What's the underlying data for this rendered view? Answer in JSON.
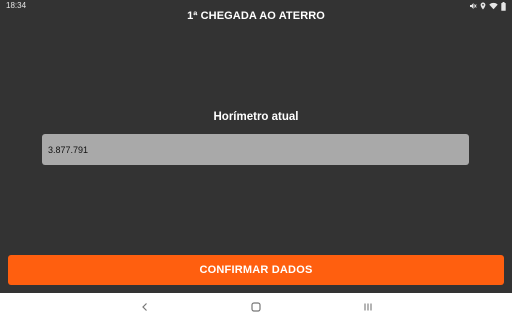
{
  "status_bar": {
    "time": "18:34",
    "icons": [
      "mute-icon",
      "location-icon",
      "wifi-icon",
      "battery-icon"
    ]
  },
  "header": {
    "title": "1ª CHEGADA AO ATERRO"
  },
  "form": {
    "field_label": "Horímetro atual",
    "field_value": "3.877.791"
  },
  "actions": {
    "confirm_label": "CONFIRMAR DADOS"
  },
  "nav_bar": {
    "buttons": [
      "back-icon",
      "home-icon",
      "recents-icon"
    ]
  },
  "colors": {
    "background": "#333333",
    "accent": "#ff5f0f",
    "field_bg": "#a9a9a9",
    "nav_bg": "#ffffff"
  }
}
